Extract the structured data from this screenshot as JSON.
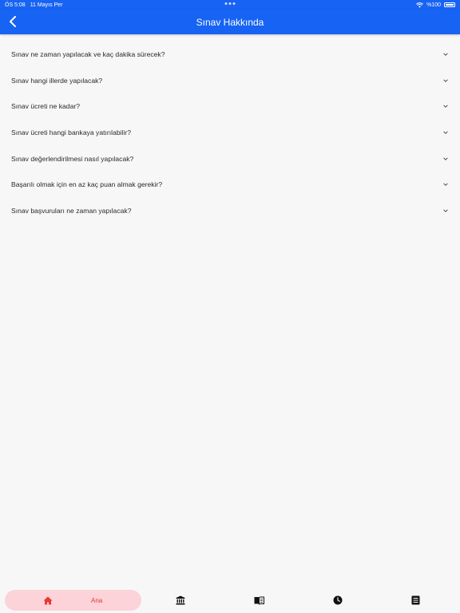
{
  "status_bar": {
    "time": "ÖS 5:08",
    "date": "11 Mayıs Per",
    "battery": "%100"
  },
  "header": {
    "title": "Sınav Hakkında",
    "back_icon": "chevron-left-icon"
  },
  "faq": [
    {
      "question": "Sınav ne zaman yapılacak ve kaç dakika sürecek?"
    },
    {
      "question": "Sınav hangi illerde yapılacak?"
    },
    {
      "question": "Sınav ücreti ne kadar?"
    },
    {
      "question": "Sınav ücreti hangi bankaya yatırılabilir?"
    },
    {
      "question": "Sınav değerlendirilmesi nasıl yapılacak?"
    },
    {
      "question": "Başarılı olmak için en az kaç puan almak gerekir?"
    },
    {
      "question": "Sınav başvuruları ne zaman yapılacak?"
    }
  ],
  "tab_bar": {
    "home_label": "Ana",
    "tabs": [
      {
        "icon": "home-icon",
        "active": true
      },
      {
        "icon": "bank-icon",
        "active": false
      },
      {
        "icon": "book-icon",
        "active": false
      },
      {
        "icon": "clock-icon",
        "active": false
      },
      {
        "icon": "list-icon",
        "active": false
      }
    ]
  },
  "colors": {
    "primary": "#1763f3",
    "active_tab_bg": "#fbd3d8",
    "active_tab_fg": "#e53935"
  }
}
